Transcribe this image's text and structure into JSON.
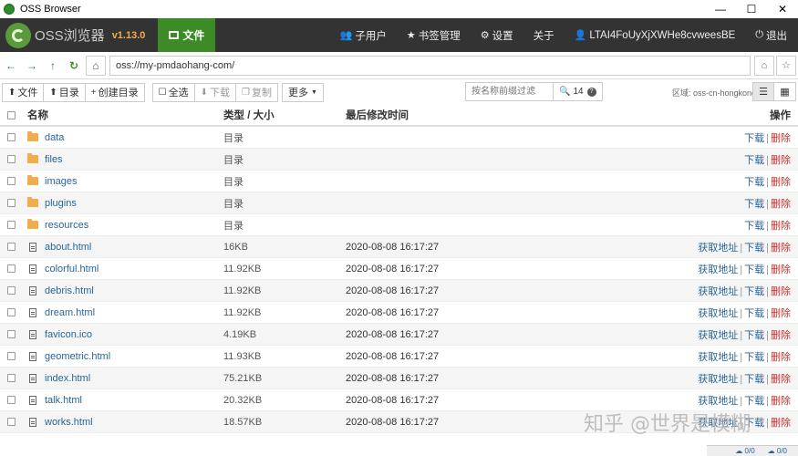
{
  "window": {
    "title": "OSS Browser",
    "minimize": "—",
    "maximize": "☐",
    "close": "✕"
  },
  "header": {
    "app_name": "OSS浏览器",
    "version": "v1.13.0",
    "file_tab": "文件",
    "nav": [
      {
        "icon": "users-icon",
        "glyph": "👥",
        "label": "子用户"
      },
      {
        "icon": "star-icon",
        "glyph": "★",
        "label": "书签管理"
      },
      {
        "icon": "gear-icon",
        "glyph": "⚙",
        "label": "设置"
      },
      {
        "icon": "",
        "glyph": "",
        "label": "关于"
      },
      {
        "icon": "user-icon",
        "glyph": "👤",
        "label": "LTAI4FoUyXjXWHe8cvweesBE"
      },
      {
        "icon": "power-icon",
        "glyph": "⏻",
        "label": "退出"
      }
    ]
  },
  "address": {
    "value": "oss://my-pmdaohang-com/"
  },
  "toolbar": {
    "upload_file": "文件",
    "upload_dir": "目录",
    "create_dir": "创建目录",
    "select_all": "全选",
    "download": "下载",
    "copy": "复制",
    "more": "更多",
    "filter_placeholder": "按名称前缀过滤",
    "count": "14",
    "region": "区域: oss-cn-hongkong"
  },
  "table": {
    "headers": {
      "name": "名称",
      "type": "类型 / 大小",
      "time": "最后修改时间",
      "action": "操作"
    },
    "action_labels": {
      "get_url": "获取地址",
      "download": "下载",
      "delete": "删除"
    },
    "rows": [
      {
        "kind": "dir",
        "name": "data",
        "type": "目录",
        "time": ""
      },
      {
        "kind": "dir",
        "name": "files",
        "type": "目录",
        "time": ""
      },
      {
        "kind": "dir",
        "name": "images",
        "type": "目录",
        "time": ""
      },
      {
        "kind": "dir",
        "name": "plugins",
        "type": "目录",
        "time": ""
      },
      {
        "kind": "dir",
        "name": "resources",
        "type": "目录",
        "time": ""
      },
      {
        "kind": "file",
        "name": "about.html",
        "type": "16KB",
        "time": "2020-08-08 16:17:27"
      },
      {
        "kind": "file",
        "name": "colorful.html",
        "type": "11.92KB",
        "time": "2020-08-08 16:17:27"
      },
      {
        "kind": "file",
        "name": "debris.html",
        "type": "11.92KB",
        "time": "2020-08-08 16:17:27"
      },
      {
        "kind": "file",
        "name": "dream.html",
        "type": "11.92KB",
        "time": "2020-08-08 16:17:27"
      },
      {
        "kind": "file",
        "name": "favicon.ico",
        "type": "4.19KB",
        "time": "2020-08-08 16:17:27"
      },
      {
        "kind": "file",
        "name": "geometric.html",
        "type": "11.93KB",
        "time": "2020-08-08 16:17:27"
      },
      {
        "kind": "file",
        "name": "index.html",
        "type": "75.21KB",
        "time": "2020-08-08 16:17:27"
      },
      {
        "kind": "file",
        "name": "talk.html",
        "type": "20.32KB",
        "time": "2020-08-08 16:17:27"
      },
      {
        "kind": "file",
        "name": "works.html",
        "type": "18.57KB",
        "time": "2020-08-08 16:17:27"
      }
    ]
  },
  "watermark": "知乎 @世界是模糊",
  "status": {
    "upload": "0/0",
    "download": "0/0"
  },
  "colors": {
    "header_bg": "#333333",
    "file_tab_bg": "#3c8b26",
    "link": "#2a6496",
    "delete": "#c9302c",
    "folder": "#f0ad4e",
    "version": "#f0ad4e"
  }
}
